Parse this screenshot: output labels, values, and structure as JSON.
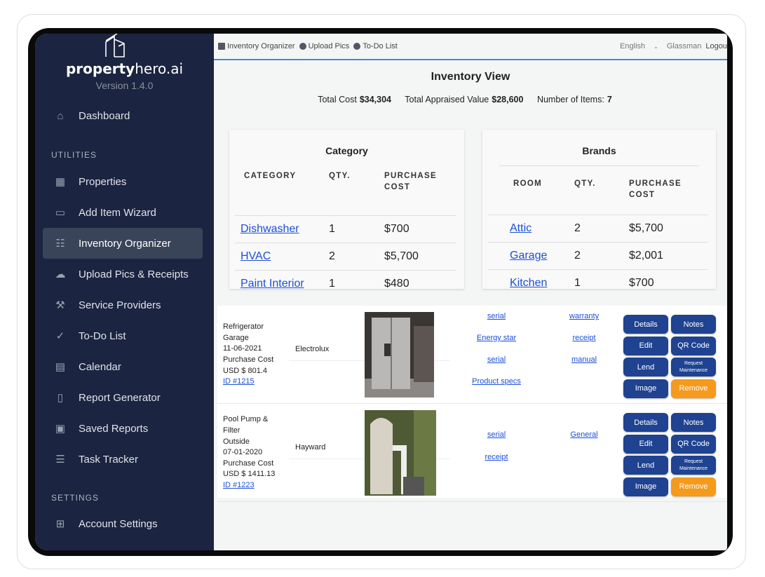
{
  "app": {
    "logo_bold": "property",
    "logo_light": "hero.ai",
    "version": "Version 1.4.0"
  },
  "sidebar": {
    "dashboard": "Dashboard",
    "utilities_heading": "UTILITIES",
    "items": [
      {
        "label": "Properties",
        "icon": "building-icon"
      },
      {
        "label": "Add Item Wizard",
        "icon": "new-badge-icon"
      },
      {
        "label": "Inventory Organizer",
        "icon": "inventory-icon",
        "active": true
      },
      {
        "label": "Upload Pics & Receipts",
        "icon": "cloud-upload-icon"
      },
      {
        "label": "Service Providers",
        "icon": "hammer-icon"
      },
      {
        "label": "To-Do List",
        "icon": "check-circle-icon"
      },
      {
        "label": "Calendar",
        "icon": "calendar-icon"
      },
      {
        "label": "Report Generator",
        "icon": "file-icon"
      },
      {
        "label": "Saved Reports",
        "icon": "briefcase-icon"
      },
      {
        "label": "Task Tracker",
        "icon": "list-icon"
      }
    ],
    "settings_heading": "SETTINGS",
    "account_settings": "Account Settings"
  },
  "topbar": {
    "links": [
      "Inventory Organizer",
      "Upload Pics",
      "To-Do List"
    ],
    "language": "English",
    "user": "Glassman",
    "logout": "Logou"
  },
  "main": {
    "title": "Inventory View",
    "total_cost_label": "Total Cost",
    "total_cost": "$34,304",
    "appraised_label": "Total Appraised Value",
    "appraised": "$28,600",
    "items_label": "Number of Items:",
    "items_count": "7"
  },
  "category_table": {
    "title": "Category",
    "headers": [
      "CATEGORY",
      "QTY.",
      "PURCHASE COST"
    ],
    "rows": [
      [
        "Dishwasher",
        "1",
        "$700"
      ],
      [
        "HVAC",
        "2",
        "$5,700"
      ],
      [
        "Paint Interior",
        "1",
        "$480"
      ]
    ]
  },
  "brands_table": {
    "title": "Brands",
    "headers": [
      "ROOM",
      "QTY.",
      "PURCHASE COST"
    ],
    "rows": [
      [
        "Attic",
        "2",
        "$5,700"
      ],
      [
        "Garage",
        "2",
        "$2,001"
      ],
      [
        "Kitchen",
        "1",
        "$700"
      ]
    ]
  },
  "items": [
    {
      "desc": [
        "Refrigerator",
        "Garage",
        "11-06-2021",
        "Purchase Cost",
        "USD $ 801.4"
      ],
      "id": "ID #1215",
      "brand": "Electrolux",
      "links_a": [
        "serial",
        "Energy star",
        "serial",
        "Product specs"
      ],
      "links_b": [
        "warranty",
        "receipt",
        "manual"
      ]
    },
    {
      "desc": [
        "Pool Pump &",
        "Filter",
        "Outside",
        "07-01-2020",
        "Purchase Cost",
        "USD $ 1411.13"
      ],
      "id": "ID #1223",
      "brand": "Hayward",
      "links_a": [
        "serial",
        "receipt"
      ],
      "links_b": [
        "General"
      ]
    }
  ],
  "buttons": {
    "details": "Details",
    "notes": "Notes",
    "edit": "Edit",
    "qr": "QR Code",
    "lend": "Lend",
    "request1": "Request",
    "request2": "Maintenance",
    "image": "Image",
    "remove": "Remove"
  },
  "colors": {
    "sidebar": "#1b2440",
    "button": "#1f4291",
    "remove": "#f59a1b",
    "link": "#1a4fd8",
    "accent": "#3b8fd9"
  }
}
